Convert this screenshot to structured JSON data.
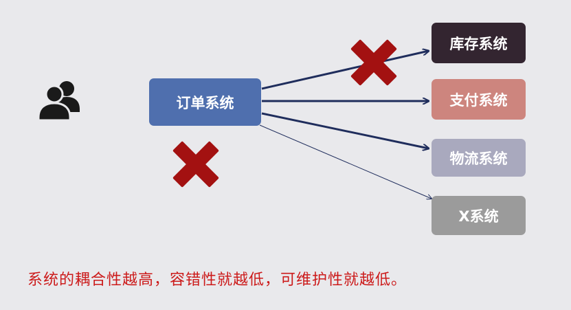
{
  "diagram": {
    "source": {
      "label": "订单系统"
    },
    "targets": [
      {
        "label": "库存系统",
        "color": "#332530"
      },
      {
        "label": "支付系统",
        "color": "#cd857e"
      },
      {
        "label": "物流系统",
        "color": "#a9a9be"
      },
      {
        "label": "X系统",
        "color": "#9b9b9b"
      }
    ],
    "icons": {
      "users": "users-icon",
      "cross": "cross-mark-icon"
    },
    "colors": {
      "arrow": "#1f2d5c",
      "cross": "#a31111",
      "caption": "#cc1a1a"
    }
  },
  "caption": "系统的耦合性越高，容错性就越低，可维护性就越低。"
}
